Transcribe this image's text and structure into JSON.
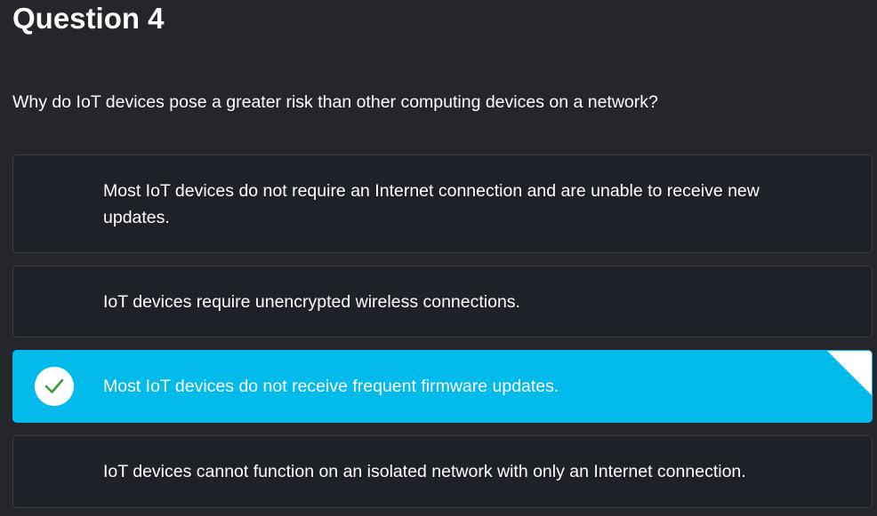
{
  "question": {
    "title": "Question 4",
    "text": "Why do IoT devices pose a greater risk than other computing devices on a network?"
  },
  "options": [
    {
      "text": "Most IoT devices do not require an Internet connection and are unable to receive new updates.",
      "selected": false
    },
    {
      "text": "IoT devices require unencrypted wireless connections.",
      "selected": false
    },
    {
      "text": "Most IoT devices do not receive frequent firmware updates.",
      "selected": true
    },
    {
      "text": "IoT devices cannot function on an isolated network with only an Internet connection.",
      "selected": false
    }
  ],
  "colors": {
    "background": "#25262b",
    "option_background": "#1f2129",
    "option_border": "#3c3e45",
    "selected_background": "#02bbea",
    "check_color": "#3c9a3c"
  },
  "icons": {
    "selected_indicator": "check-icon",
    "corner_marker": "corner-triangle"
  }
}
